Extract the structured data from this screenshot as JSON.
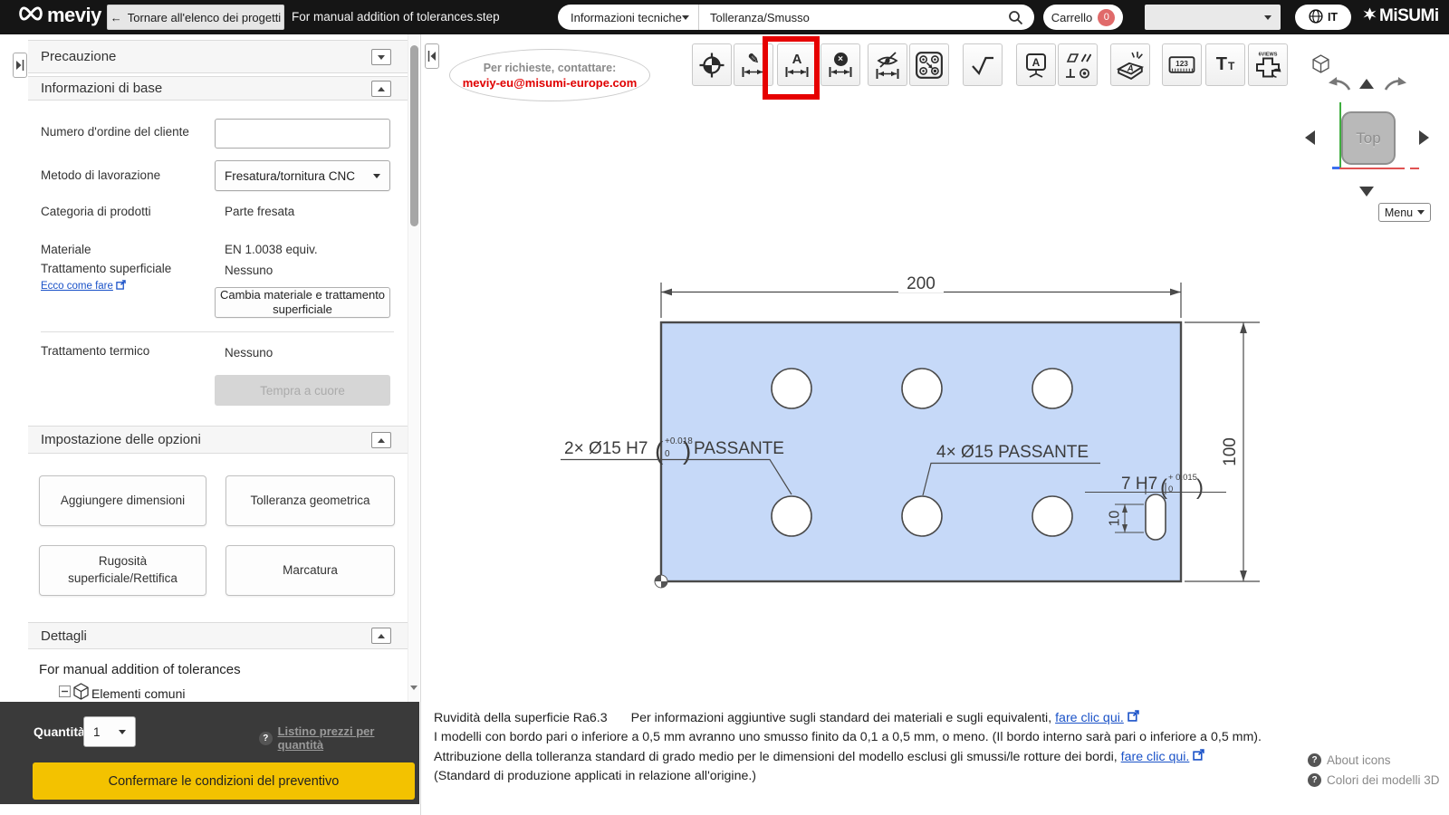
{
  "icons": {
    "question": "?"
  },
  "topbar": {
    "logo_text": "meviy",
    "back_arrow": "←",
    "back_button": "Tornare all'elenco dei progetti",
    "file_title": "For manual addition of tolerances.step",
    "category_dropdown": "Informazioni tecniche",
    "search_value": "Tolleranza/Smusso",
    "cart_label": "Carrello",
    "cart_count": "0",
    "language": "IT",
    "brand": "MiSUMi"
  },
  "sidebar": {
    "precauzione_header": "Precauzione",
    "info_header": "Informazioni di base",
    "order_label": "Numero d'ordine del cliente",
    "method_label": "Metodo di lavorazione",
    "method_value": "Fresatura/tornitura CNC",
    "category_label": "Categoria di prodotti",
    "category_value": "Parte fresata",
    "material_label": "Materiale",
    "surface_label": "Trattamento superficiale",
    "material_value": "EN 1.0038 equiv.",
    "surface_value": "Nessuno",
    "howto_link": "Ecco come fare",
    "change_material_button": "Cambia materiale e trattamento superficiale",
    "heat_label": "Trattamento termico",
    "heat_value": "Nessuno",
    "heat_button": "Tempra a cuore",
    "options_header": "Impostazione delle opzioni",
    "option_buttons": [
      "Aggiungere dimensioni",
      "Tolleranza geometrica",
      "Rugosità superficiale/Rettifica",
      "Marcatura"
    ],
    "details_header": "Dettagli",
    "part_name": "For manual addition of tolerances",
    "tree_item": "Elementi comuni",
    "qty_label": "Quantità",
    "qty_value": "1",
    "price_list_link": "Listino prezzi per quantità",
    "confirm_button": "Confermare le condizioni del preventivo"
  },
  "canvas": {
    "contact_line": "Per richieste, contattare:",
    "contact_email": "meviy-eu@misumi-europe.com",
    "toolbar": [
      {
        "name": "datum-target"
      },
      {
        "name": "add-dimension",
        "glyph": "✎"
      },
      {
        "name": "add-text-dimension",
        "glyph": "A",
        "highlighted": "true"
      },
      {
        "name": "delete-dimension",
        "glyph": "×"
      },
      {
        "name": "hide-dimension"
      },
      {
        "name": "hole-pattern"
      },
      {
        "name": "surface-roughness"
      },
      {
        "name": "marking-sign",
        "glyph": "A"
      },
      {
        "name": "geometric-tolerance"
      },
      {
        "name": "engraving-stamp",
        "glyph": "A"
      },
      {
        "name": "measure-numbers",
        "glyph": "123"
      },
      {
        "name": "text-size",
        "glyph": "T",
        "glyph_small": "T"
      },
      {
        "name": "six-views",
        "glyph": "6VIEWS"
      }
    ],
    "viewcube": {
      "face_label": "Top",
      "menu_label": "Menu"
    },
    "notes": {
      "roughness": "Ruvidità della superficie Ra6.3",
      "line1": "Per informazioni aggiuntive sugli standard dei materiali e sugli equivalenti,",
      "line1_link": "fare clic qui.",
      "line2": "I modelli con bordo pari o inferiore a 0,5 mm avranno uno smusso finito da 0,1 a 0,5 mm, o meno. (Il bordo interno sarà pari o inferiore a 0,5 mm).",
      "line3": "Attribuzione della tolleranza standard di grado medio per le dimensioni del modello esclusi gli smussi/le rotture dei bordi,",
      "line3_link": "fare clic qui.",
      "line4": "(Standard di produzione applicati in relazione all'origine.)"
    },
    "help": {
      "about_icons": "About icons",
      "colors_3d": "Colori dei modelli 3D"
    }
  },
  "drawing": {
    "dim_width": "200",
    "dim_height": "100",
    "holes2_prefix": "2× Ø15 H7",
    "holes2_tol_top": "+0.018",
    "holes2_tol_bottom": "0",
    "holes2_suffix": "PASSANTE",
    "holes4_label": "4× Ø15 PASSANTE",
    "slot_prefix": "7 H7",
    "slot_tol_top": "+ 0.015",
    "slot_tol_bottom": "0",
    "dim_slot": "10",
    "paren_open": "(",
    "paren_close": ")"
  },
  "colors": {
    "accent_yellow": "#f3c200",
    "plate_fill": "#c6d9f8",
    "highlight_red": "#e60000",
    "badge_red": "#e06a6a",
    "link_blue": "#1a52c8",
    "email_red": "#e00000"
  }
}
